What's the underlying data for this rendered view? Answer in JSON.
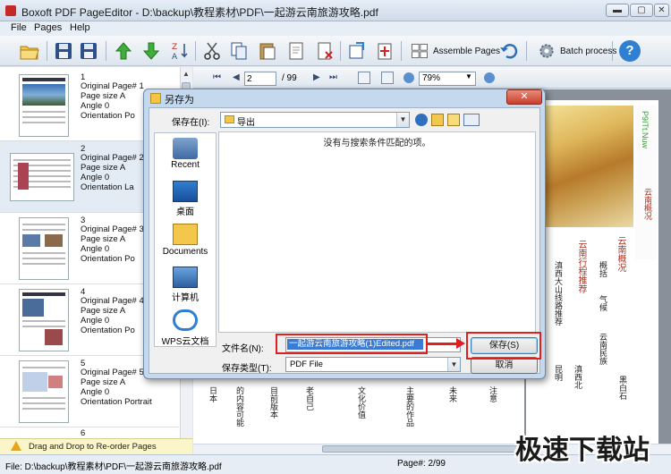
{
  "window": {
    "title": "Boxoft PDF PageEditor - D:\\backup\\教程素材\\PDF\\一起游云南旅游攻略.pdf",
    "min_glyph": "▬",
    "max_glyph": "▢",
    "close_glyph": "✕"
  },
  "menu": [
    "File",
    "Pages",
    "Help"
  ],
  "toolbar": {
    "assemble_label": "Assemble Pages",
    "batch_label": "Batch process",
    "help_glyph": "?"
  },
  "thumbnails": [
    {
      "num": "1",
      "original_page": "Original Page#  1",
      "page_size": "Page size    A",
      "angle": "Angle          0",
      "orientation": "Orientation   Po"
    },
    {
      "num": "2",
      "original_page": "Original Page#  2",
      "page_size": "Page size    A",
      "angle": "Angle          0",
      "orientation": "Orientation   La"
    },
    {
      "num": "3",
      "original_page": "Original Page#  3",
      "page_size": "Page size    A",
      "angle": "Angle          0",
      "orientation": "Orientation   Po"
    },
    {
      "num": "4",
      "original_page": "Original Page#  4",
      "page_size": "Page size    A",
      "angle": "Angle          0",
      "orientation": "Orientation   Po"
    },
    {
      "num": "5",
      "original_page": "Original Page#  5",
      "page_size": "Page size    A",
      "angle": "Angle          0",
      "orientation": "Orientation   Portrait"
    },
    {
      "num": "6"
    }
  ],
  "hint": "Drag and Drop to Re-order Pages",
  "nav": {
    "first": "⏮",
    "prev": "◀",
    "next": "▶",
    "last": "⏭",
    "page_value": "2",
    "page_total": "/ 99",
    "zoom_value": "79%"
  },
  "document": {
    "red_heading_1": "云南概况",
    "red_heading_2": "云南行程推荐",
    "green_text": "P9ITt.Nuw",
    "col_texts": [
      "概括",
      "气候",
      "云南民族",
      "滇西大山线路推荐",
      "昆明",
      "滇西北",
      "黑白石"
    ],
    "bottom_texts": [
      "日本",
      "的内容可能",
      "目前版本",
      "老自己",
      "文化价值",
      "主要的作品",
      "未来",
      "注意"
    ]
  },
  "status": {
    "file": "File: D:\\backup\\教程素材\\PDF\\一起游云南旅游攻略.pdf",
    "page": "Page#: 2/99"
  },
  "watermark": "极速下载站",
  "dialog": {
    "title": "另存为",
    "save_in_label": "保存在(I):",
    "save_in_value": "导出",
    "empty_message": "没有与搜索条件匹配的项。",
    "places": [
      "Recent",
      "桌面",
      "Documents",
      "计算机",
      "WPS云文档"
    ],
    "filename_label": "文件名(N):",
    "filename_value": "一起游云南旅游攻略(1)Edited.pdf",
    "filetype_label": "保存类型(T):",
    "filetype_value": "PDF File",
    "save_button": "保存(S)",
    "cancel_button": "取消",
    "close_glyph": "✕"
  }
}
